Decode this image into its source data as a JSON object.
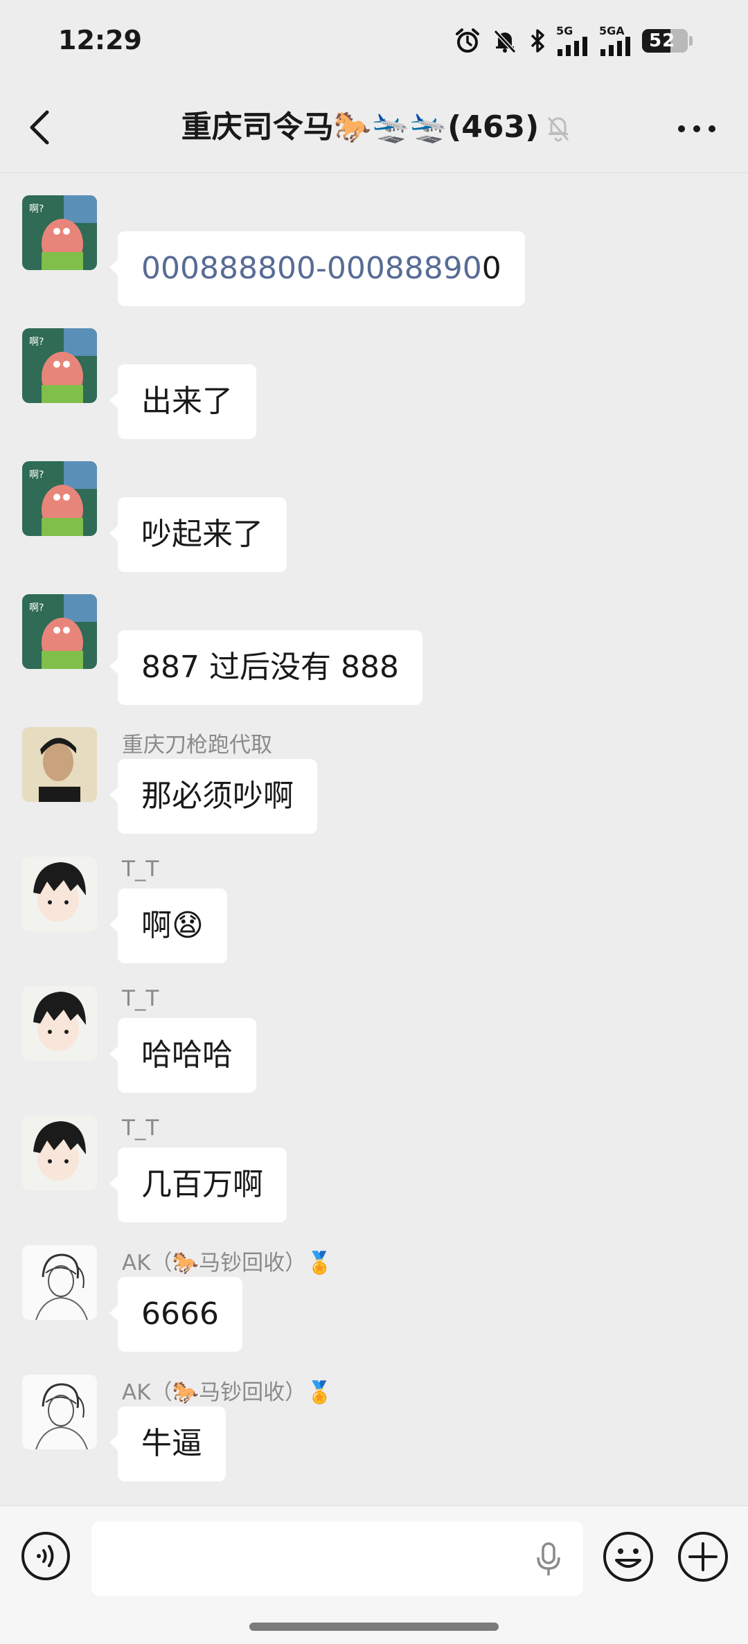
{
  "status_bar": {
    "time": "12:29",
    "network_1": "5G",
    "network_2": "5GA",
    "battery": "52"
  },
  "header": {
    "title": "重庆司令马🐎🛬🛬(463)",
    "icons": [
      "back-icon",
      "mute-bell-icon",
      "more-icon"
    ]
  },
  "messages": [
    {
      "sender": "",
      "avatar": "patrick-avatar",
      "text_link": "000888800-00088890",
      "text_rest": "0"
    },
    {
      "sender": "",
      "avatar": "patrick-avatar",
      "text": "出来了"
    },
    {
      "sender": "",
      "avatar": "patrick-avatar",
      "text": "吵起来了"
    },
    {
      "sender": "",
      "avatar": "patrick-avatar",
      "text": "887 过后没有 888"
    },
    {
      "sender": "重庆刀枪跑代取",
      "avatar": "man-photo-avatar",
      "text": "那必须吵啊"
    },
    {
      "sender": "T_T",
      "avatar": "anime-boy-avatar",
      "text": "啊😧"
    },
    {
      "sender": "T_T",
      "avatar": "anime-boy-avatar",
      "text": "哈哈哈"
    },
    {
      "sender": "T_T",
      "avatar": "anime-boy-avatar",
      "text": "几百万啊"
    },
    {
      "sender": "AK（🐎马钞回收）🏅",
      "avatar": "sketch-avatar",
      "text": "6666"
    },
    {
      "sender": "AK（🐎马钞回收）🏅",
      "avatar": "sketch-avatar",
      "text": "牛逼"
    }
  ],
  "input_bar": {
    "value": "",
    "icons": [
      "voice-icon",
      "mic-icon",
      "emoji-icon",
      "plus-icon"
    ]
  },
  "colors": {
    "background": "#ededed",
    "bubble": "#ffffff",
    "link": "#576b95",
    "sender": "#8a8a8a"
  }
}
